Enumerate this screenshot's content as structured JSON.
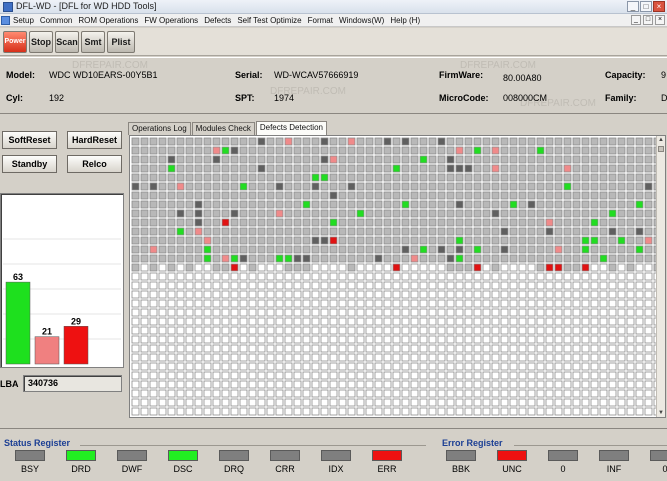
{
  "window": {
    "title": "DFL-WD - [DFL for WD HDD Tools]",
    "minimize": "_",
    "maximize": "□",
    "close": "×"
  },
  "menu": {
    "items": [
      "Setup",
      "Common",
      "ROM Operations",
      "FW Operations",
      "Defects",
      "Self Test Optimize",
      "Format",
      "Windows(W)",
      "Help (H)"
    ],
    "mdi_minimize": "_",
    "mdi_restore": "□",
    "mdi_close": "×"
  },
  "toolbar": {
    "power": "Power",
    "stop": "Stop",
    "scan": "Scan",
    "smt": "Smt",
    "plist": "Plist"
  },
  "info": {
    "model_label": "Model:",
    "model": "WDC WD10EARS-00Y5B1",
    "serial_label": "Serial:",
    "serial": "WD-WCAV57666919",
    "firmware_label": "FirmWare:",
    "firmware": "80.00A80",
    "capacity_label": "Capacity:",
    "capacity": "9",
    "cyl_label": "Cyl:",
    "cyl": "192",
    "spt_label": "SPT:",
    "spt": "1974",
    "microcode_label": "MicroCode:",
    "microcode": "008000CM",
    "family_label": "Family:",
    "family": "D",
    "watermark": "DFREPAIR.COM"
  },
  "controls": {
    "soft_reset": "SoftReset",
    "hard_reset": "HardReset",
    "standby": "Standby",
    "relco": "Relco"
  },
  "chart_data": {
    "type": "bar",
    "categories": [
      "",
      "",
      ""
    ],
    "values": [
      63,
      21,
      29
    ],
    "colors": [
      "#1ee01e",
      "#f08080",
      "#ee1111"
    ],
    "ylim": [
      0,
      100
    ]
  },
  "lba": {
    "label": "LBA",
    "value": "340736"
  },
  "tabs": [
    "Operations Log",
    "Modules Check",
    "Defects Detection"
  ],
  "active_tab": 2,
  "defect_map": {
    "columns": 59,
    "rows": 31,
    "status_colors": {
      "unscanned": "#ffffff",
      "normal": "#b8b8b8",
      "slow": "#606060",
      "good": "#22dd22",
      "warning": "#f08a8a",
      "error": "#e01212"
    },
    "scanned_rows": 15
  },
  "status_register": {
    "title": "Status Register",
    "flags": [
      {
        "name": "BSY",
        "color": "#7f7f7f"
      },
      {
        "name": "DRD",
        "color": "#22ee22"
      },
      {
        "name": "DWF",
        "color": "#7f7f7f"
      },
      {
        "name": "DSC",
        "color": "#22ee22"
      },
      {
        "name": "DRQ",
        "color": "#7f7f7f"
      },
      {
        "name": "CRR",
        "color": "#7f7f7f"
      },
      {
        "name": "IDX",
        "color": "#7f7f7f"
      },
      {
        "name": "ERR",
        "color": "#ee1111"
      }
    ]
  },
  "error_register": {
    "title": "Error Register",
    "flags": [
      {
        "name": "BBK",
        "color": "#7f7f7f"
      },
      {
        "name": "UNC",
        "color": "#ee1111"
      },
      {
        "name": "0",
        "color": "#7f7f7f"
      },
      {
        "name": "INF",
        "color": "#7f7f7f"
      },
      {
        "name": "0",
        "color": "#7f7f7f"
      }
    ]
  }
}
